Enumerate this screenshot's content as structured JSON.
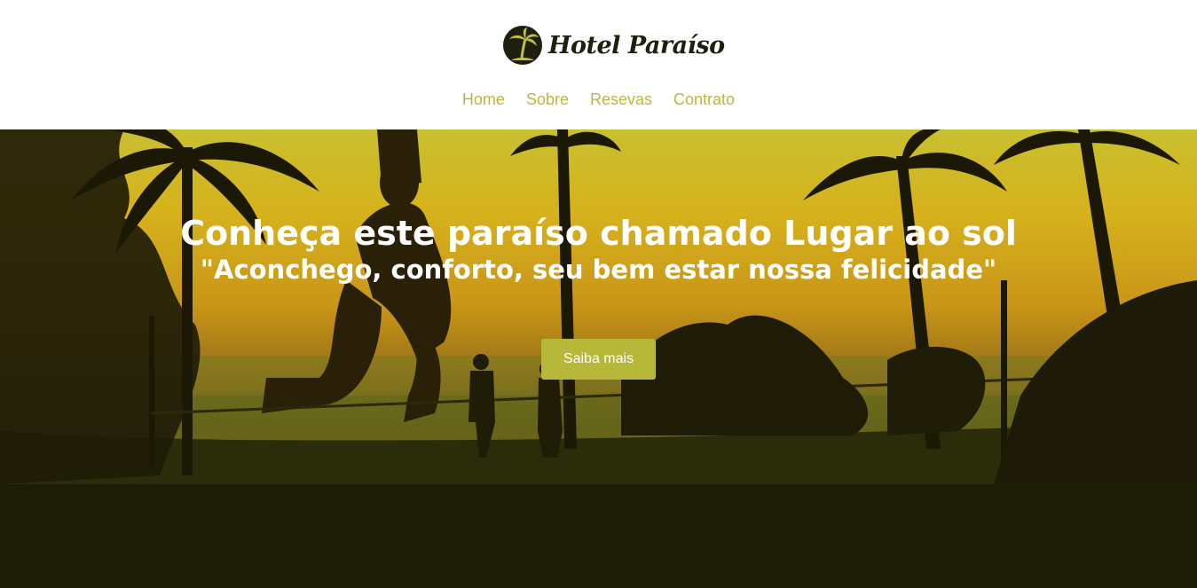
{
  "brand": {
    "name": "Hotel Paraíso",
    "logo_icon": "palm-tree-icon",
    "colors": {
      "accent": "#b9b83e",
      "logo_circle": "#1f1f10",
      "logo_palm": "#c4c23a"
    }
  },
  "nav": {
    "items": [
      {
        "label": "Home"
      },
      {
        "label": "Sobre"
      },
      {
        "label": "Resevas"
      },
      {
        "label": "Contrato"
      }
    ]
  },
  "hero": {
    "title": "Conheça este paraíso chamado Lugar ao sol",
    "subtitle": "\"Aconchego, conforto, seu bem estar nossa felicidade\"",
    "cta_label": "Saiba mais",
    "background_image": "sunset-beach-slackline-silhouette"
  }
}
